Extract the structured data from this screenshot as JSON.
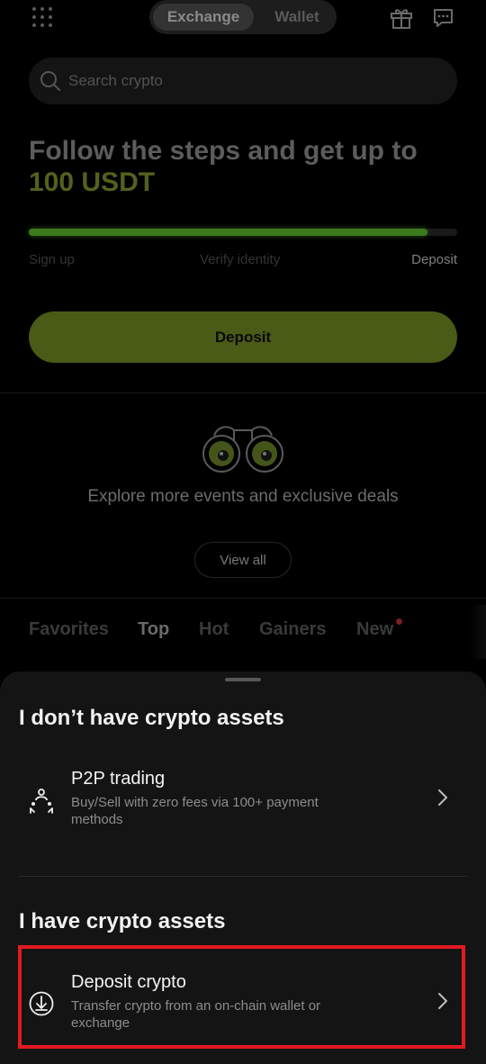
{
  "header": {
    "tabs": [
      {
        "label": "Exchange",
        "active": true
      },
      {
        "label": "Wallet",
        "active": false
      }
    ]
  },
  "search": {
    "placeholder": "Search crypto"
  },
  "promo": {
    "title": "Follow the steps and get up to",
    "highlight": "100 USDT",
    "progress_fraction": 0.93,
    "steps": [
      "Sign up",
      "Verify identity",
      "Deposit"
    ],
    "cta": "Deposit"
  },
  "explore": {
    "text": "Explore more events and exclusive deals",
    "button": "View all"
  },
  "market": {
    "tabs": [
      "Favorites",
      "Top",
      "Hot",
      "Gainers",
      "New"
    ],
    "active_tab": "Top"
  },
  "sheet": {
    "section1_title": "I don’t have crypto assets",
    "option1": {
      "title": "P2P trading",
      "description": "Buy/Sell with zero fees via 100+ payment methods",
      "icon": "p2p-icon"
    },
    "section2_title": "I have crypto assets",
    "option2": {
      "title": "Deposit crypto",
      "description": "Transfer crypto from an on-chain wallet or exchange",
      "icon": "deposit-icon"
    }
  },
  "colors": {
    "accent": "#52621e",
    "progress": "#3c7a1d",
    "highlight_border": "#e21a22",
    "sheet_bg": "#141414"
  }
}
